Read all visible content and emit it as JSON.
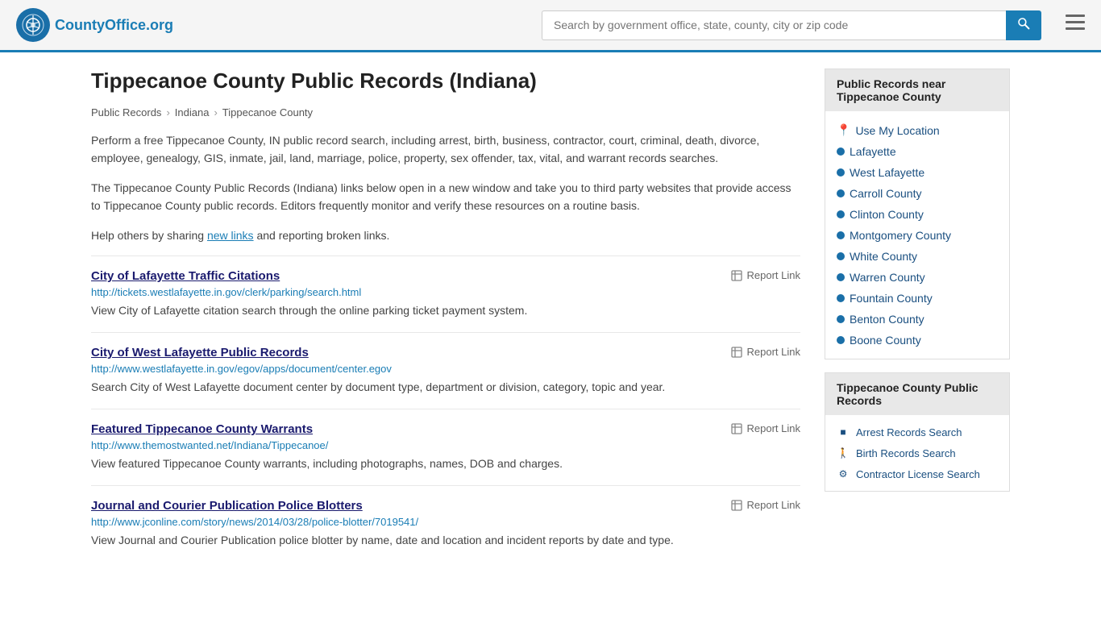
{
  "header": {
    "logo_text": "CountyOffice",
    "logo_tld": ".org",
    "search_placeholder": "Search by government office, state, county, city or zip code"
  },
  "page": {
    "title": "Tippecanoe County Public Records (Indiana)",
    "breadcrumbs": [
      {
        "label": "Public Records",
        "href": "#"
      },
      {
        "label": "Indiana",
        "href": "#"
      },
      {
        "label": "Tippecanoe County",
        "href": "#"
      }
    ],
    "description1": "Perform a free Tippecanoe County, IN public record search, including arrest, birth, business, contractor, court, criminal, death, divorce, employee, genealogy, GIS, inmate, jail, land, marriage, police, property, sex offender, tax, vital, and warrant records searches.",
    "description2": "The Tippecanoe County Public Records (Indiana) links below open in a new window and take you to third party websites that provide access to Tippecanoe County public records. Editors frequently monitor and verify these resources on a routine basis.",
    "description3_pre": "Help others by sharing ",
    "description3_link": "new links",
    "description3_post": " and reporting broken links."
  },
  "records": [
    {
      "title": "City of Lafayette Traffic Citations",
      "url": "http://tickets.westlafayette.in.gov/clerk/parking/search.html",
      "description": "View City of Lafayette citation search through the online parking ticket payment system.",
      "report_label": "Report Link"
    },
    {
      "title": "City of West Lafayette Public Records",
      "url": "http://www.westlafayette.in.gov/egov/apps/document/center.egov",
      "description": "Search City of West Lafayette document center by document type, department or division, category, topic and year.",
      "report_label": "Report Link"
    },
    {
      "title": "Featured Tippecanoe County Warrants",
      "url": "http://www.themostwanted.net/Indiana/Tippecanoe/",
      "description": "View featured Tippecanoe County warrants, including photographs, names, DOB and charges.",
      "report_label": "Report Link"
    },
    {
      "title": "Journal and Courier Publication Police Blotters",
      "url": "http://www.jconline.com/story/news/2014/03/28/police-blotter/7019541/",
      "description": "View Journal and Courier Publication police blotter by name, date and location and incident reports by date and type.",
      "report_label": "Report Link"
    }
  ],
  "sidebar": {
    "nearby_section": {
      "header": "Public Records near Tippecanoe County",
      "use_my_location": "Use My Location",
      "links": [
        "Lafayette",
        "West Lafayette",
        "Carroll County",
        "Clinton County",
        "Montgomery County",
        "White County",
        "Warren County",
        "Fountain County",
        "Benton County",
        "Boone County"
      ]
    },
    "records_section": {
      "header": "Tippecanoe County Public Records",
      "items": [
        {
          "label": "Arrest Records Search",
          "icon": "arrest"
        },
        {
          "label": "Birth Records Search",
          "icon": "birth"
        },
        {
          "label": "Contractor License Search",
          "icon": "contractor"
        }
      ]
    }
  }
}
